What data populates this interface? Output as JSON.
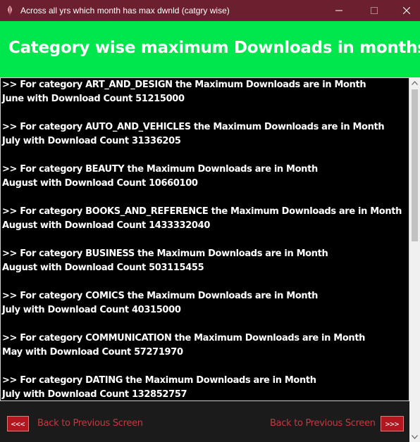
{
  "window": {
    "title": "Across all yrs which month has max dwnld (catgry wise)"
  },
  "header": {
    "title": "Category wise maximum Downloads in months"
  },
  "entries": [
    {
      "line1": ">>  For category ART_AND_DESIGN the Maximum Downloads are in Month",
      "line2": "June with Download Count 51215000"
    },
    {
      "line1": ">>  For category AUTO_AND_VEHICLES the Maximum Downloads are in Month",
      "line2": "July with Download Count 31336205"
    },
    {
      "line1": ">>  For category BEAUTY the Maximum Downloads are in Month",
      "line2": "August with Download Count 10660100"
    },
    {
      "line1": ">>  For category BOOKS_AND_REFERENCE the Maximum Downloads are in Month",
      "line2": "August with Download Count 1433332040"
    },
    {
      "line1": ">>  For category BUSINESS the Maximum Downloads are in Month",
      "line2": "August with Download Count 503115455"
    },
    {
      "line1": ">>  For category COMICS the Maximum Downloads are in Month",
      "line2": "July with Download Count 40315000"
    },
    {
      "line1": ">>  For category COMMUNICATION the Maximum Downloads are in Month",
      "line2": "May with Download Count 57271970"
    },
    {
      "line1": ">>  For category DATING the Maximum Downloads are in Month",
      "line2": "July with Download Count 132852757"
    }
  ],
  "footer": {
    "prev_button": "<<<",
    "prev_label": "Back to Previous Screen",
    "next_label": "Back to Previous Screen",
    "next_button": ">>>"
  },
  "colors": {
    "titlebar": "#6b1f2f",
    "header": "#00e64d",
    "content_bg": "#000000",
    "nav_button": "#b3161e",
    "nav_label": "#c23a3f"
  },
  "icons": {
    "app": "feather-app-icon",
    "minimize": "minimize-icon",
    "maximize": "maximize-icon",
    "close": "close-icon",
    "scroll_up": "scroll-up-arrow-icon",
    "scroll_down": "scroll-down-arrow-icon"
  }
}
